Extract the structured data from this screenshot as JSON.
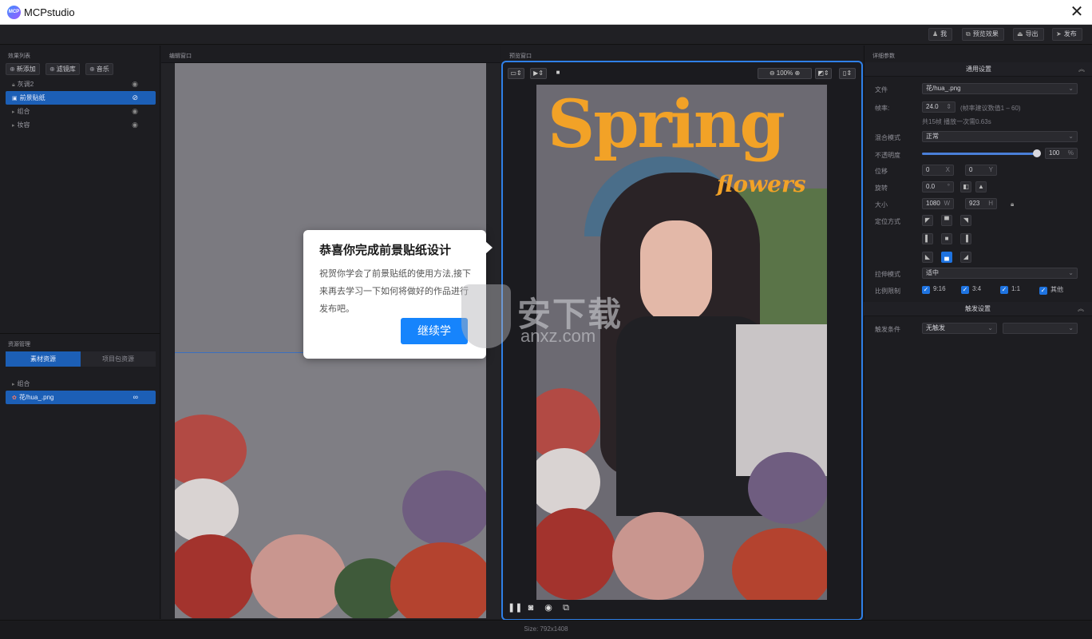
{
  "app": {
    "title": "MCPstudio",
    "logo_text": "MCP"
  },
  "toolbar": {
    "me": "我",
    "preview_effect": "预览效果",
    "export": "导出",
    "publish": "发布"
  },
  "left": {
    "effects_header": "效果列表",
    "buttons": [
      "新添加",
      "滤镜库",
      "音乐"
    ],
    "layers": [
      {
        "label": "灰调2",
        "selected": false
      },
      {
        "label": "前景贴纸",
        "selected": true
      },
      {
        "label": "组合",
        "selected": false
      },
      {
        "label": "妆容",
        "selected": false
      }
    ],
    "resources_header": "资源管理",
    "tabs": [
      "素材资源",
      "项目包资源"
    ],
    "resource_items": [
      {
        "label": "组合"
      },
      {
        "label": "花/hua_.png"
      }
    ]
  },
  "edit": {
    "header": "编辑窗口"
  },
  "popup": {
    "title": "恭喜你完成前景贴纸设计",
    "body": "祝贺你学会了前景贴纸的使用方法,接下来再去学习一下如何将做好的作品进行发布吧。",
    "button": "继续学"
  },
  "preview": {
    "header": "预览窗口",
    "zoom": "100%",
    "title_text": "Spring",
    "subtitle_text": "flowers"
  },
  "right": {
    "header": "详细参数",
    "general_section": "通用设置",
    "file_label": "文件",
    "file_value": "花/hua_.png",
    "fps_label": "帧率:",
    "fps_value": "24.0",
    "fps_hint": "(帧率建议数值1 – 60)",
    "frames_info": "共15帧 播放一次需0.63s",
    "blend_label": "混合模式",
    "blend_value": "正常",
    "opacity_label": "不透明度",
    "opacity_value": "100",
    "opacity_unit": "%",
    "position_label": "位移",
    "pos_x": "0",
    "pos_y": "0",
    "x": "X",
    "y": "Y",
    "rotate_label": "旋转",
    "rotate_value": "0.0",
    "rotate_unit": "°",
    "size_label": "大小",
    "size_w": "1080",
    "size_h": "923",
    "w": "W",
    "h": "H",
    "anchor_label": "定位方式",
    "stretch_label": "拉伸模式",
    "stretch_value": "适中",
    "ratio_label": "比例限制",
    "ratios": [
      "9:16",
      "3:4",
      "1:1",
      "其他"
    ],
    "trigger_section": "触发设置",
    "trigger_label": "触发条件",
    "trigger_value": "无触发"
  },
  "status": {
    "size": "Size: 792x1408"
  },
  "watermark": {
    "text": "安下载",
    "sub": "anxz.com"
  }
}
